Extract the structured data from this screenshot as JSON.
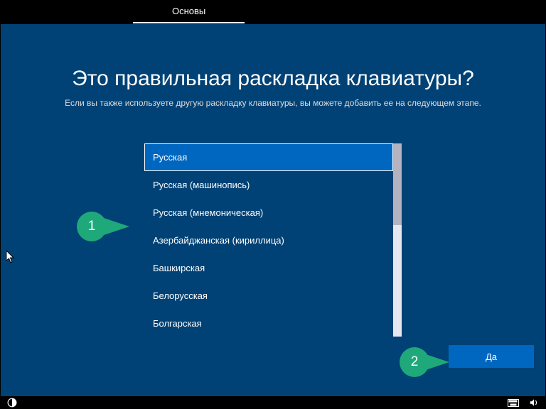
{
  "top": {
    "tab": "Основы"
  },
  "heading": "Это правильная раскладка клавиатуры?",
  "subheading": "Если вы также используете другую раскладку клавиатуры, вы можете добавить ее на следующем этапе.",
  "layouts": [
    "Русская",
    "Русская (машинопись)",
    "Русская (мнемоническая)",
    "Азербайджанская (кириллица)",
    "Башкирская",
    "Белорусская",
    "Болгарская"
  ],
  "selected_index": 0,
  "yes_label": "Да",
  "annotations": {
    "a1": "1",
    "a2": "2"
  }
}
